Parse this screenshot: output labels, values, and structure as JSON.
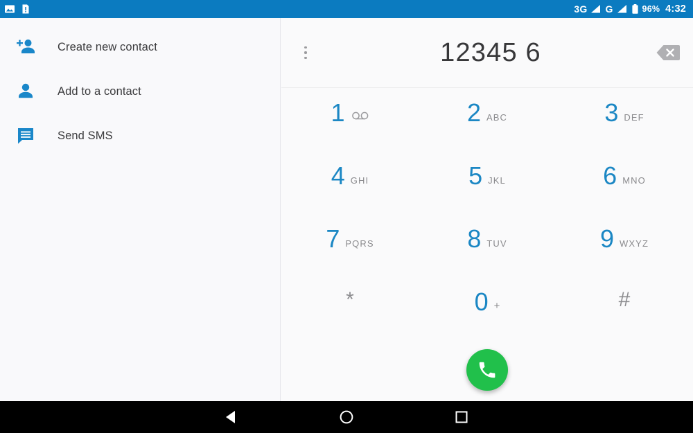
{
  "status_bar": {
    "background_color": "#0b7bc0",
    "left_icons": [
      {
        "name": "photo-icon",
        "label": "image"
      },
      {
        "name": "sim-alert-icon",
        "label": "sim card alert"
      }
    ],
    "network_1": "3G",
    "network_2": "G",
    "battery_percent": "96%",
    "time": "4:32"
  },
  "left_panel": {
    "items": [
      {
        "id": "create-new-contact",
        "label": "Create new contact",
        "icon": "person-add-icon"
      },
      {
        "id": "add-to-a-contact",
        "label": "Add to a contact",
        "icon": "person-icon"
      },
      {
        "id": "send-sms",
        "label": "Send SMS",
        "icon": "message-icon"
      }
    ],
    "icon_color": "#1a87c9",
    "background_color": "#f9f9fb"
  },
  "dialer": {
    "dialed_number": "12345 6",
    "overflow_menu_label": "More options",
    "backspace_label": "Backspace",
    "accent_color": "#1b87c4",
    "keys": [
      [
        {
          "digit": "1",
          "sub": "",
          "icon": "voicemail-icon"
        },
        {
          "digit": "2",
          "sub": "ABC",
          "icon": ""
        },
        {
          "digit": "3",
          "sub": "DEF",
          "icon": ""
        }
      ],
      [
        {
          "digit": "4",
          "sub": "GHI",
          "icon": ""
        },
        {
          "digit": "5",
          "sub": "JKL",
          "icon": ""
        },
        {
          "digit": "6",
          "sub": "MNO",
          "icon": ""
        }
      ],
      [
        {
          "digit": "7",
          "sub": "PQRS",
          "icon": ""
        },
        {
          "digit": "8",
          "sub": "TUV",
          "icon": ""
        },
        {
          "digit": "9",
          "sub": "WXYZ",
          "icon": ""
        }
      ],
      [
        {
          "digit": "*",
          "sub": "",
          "icon": ""
        },
        {
          "digit": "0",
          "sub": "+",
          "icon": ""
        },
        {
          "digit": "#",
          "sub": "",
          "icon": ""
        }
      ]
    ],
    "call_button": {
      "label": "Call",
      "icon": "phone-icon",
      "color": "#21c04b"
    }
  },
  "nav_bar": {
    "background_color": "#000000",
    "buttons": [
      {
        "id": "back",
        "icon": "back-triangle-icon"
      },
      {
        "id": "home",
        "icon": "home-circle-icon"
      },
      {
        "id": "recents",
        "icon": "recents-square-icon"
      }
    ]
  }
}
